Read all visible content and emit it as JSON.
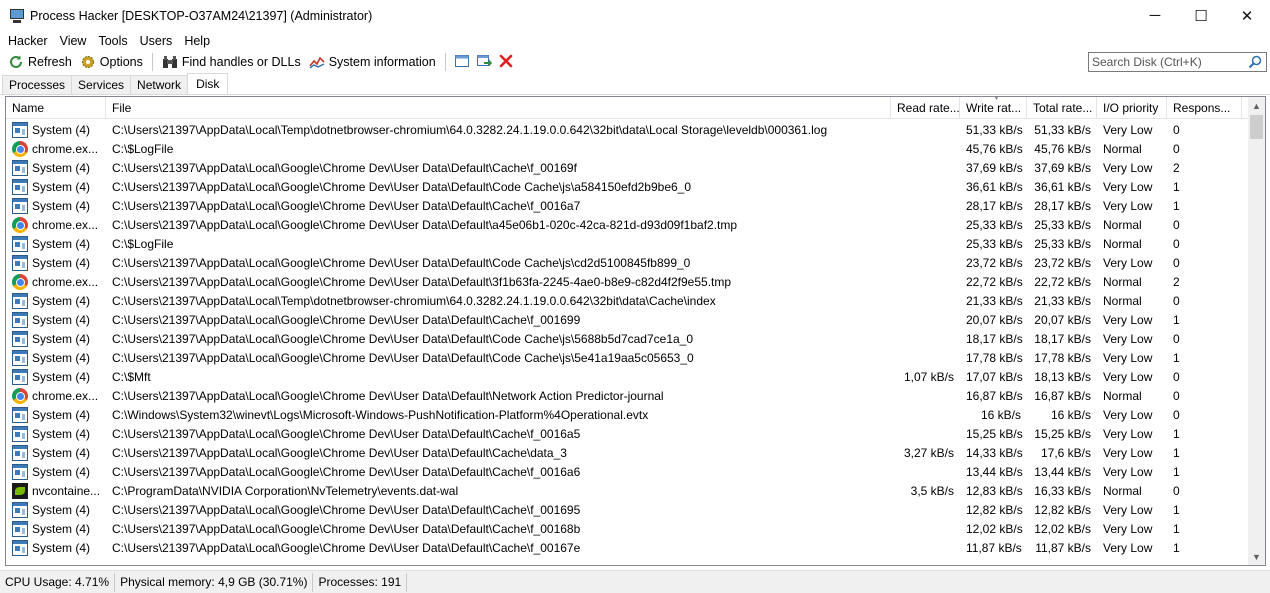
{
  "window": {
    "title": "Process Hacker [DESKTOP-O37AM24\\21397] (Administrator)",
    "controls": {
      "minimize": "─",
      "maximize": "☐",
      "close": "✕"
    }
  },
  "menu": [
    "Hacker",
    "View",
    "Tools",
    "Users",
    "Help"
  ],
  "toolbar": {
    "refresh": "Refresh",
    "options": "Options",
    "find": "Find handles or DLLs",
    "sysinfo": "System information"
  },
  "search": {
    "placeholder": "Search Disk (Ctrl+K)"
  },
  "tabs": [
    "Processes",
    "Services",
    "Network",
    "Disk"
  ],
  "active_tab": "Disk",
  "columns": [
    "Name",
    "File",
    "Read rate...",
    "Write rat...",
    "Total rate...",
    "I/O priority",
    "Respons..."
  ],
  "rows": [
    {
      "icon": "system",
      "name": "System (4)",
      "file": "C:\\Users\\21397\\AppData\\Local\\Temp\\dotnetbrowser-chromium\\64.0.3282.24.1.19.0.0.642\\32bit\\data\\Local Storage\\leveldb\\000361.log",
      "read": "",
      "write": "51,33 kB/s",
      "total": "51,33 kB/s",
      "priority": "Very Low",
      "resp": "0"
    },
    {
      "icon": "chrome",
      "name": "chrome.ex...",
      "file": "C:\\$LogFile",
      "read": "",
      "write": "45,76 kB/s",
      "total": "45,76 kB/s",
      "priority": "Normal",
      "resp": "0"
    },
    {
      "icon": "system",
      "name": "System (4)",
      "file": "C:\\Users\\21397\\AppData\\Local\\Google\\Chrome Dev\\User Data\\Default\\Cache\\f_00169f",
      "read": "",
      "write": "37,69 kB/s",
      "total": "37,69 kB/s",
      "priority": "Very Low",
      "resp": "2"
    },
    {
      "icon": "system",
      "name": "System (4)",
      "file": "C:\\Users\\21397\\AppData\\Local\\Google\\Chrome Dev\\User Data\\Default\\Code Cache\\js\\a584150efd2b9be6_0",
      "read": "",
      "write": "36,61 kB/s",
      "total": "36,61 kB/s",
      "priority": "Very Low",
      "resp": "1"
    },
    {
      "icon": "system",
      "name": "System (4)",
      "file": "C:\\Users\\21397\\AppData\\Local\\Google\\Chrome Dev\\User Data\\Default\\Cache\\f_0016a7",
      "read": "",
      "write": "28,17 kB/s",
      "total": "28,17 kB/s",
      "priority": "Very Low",
      "resp": "1"
    },
    {
      "icon": "chrome",
      "name": "chrome.ex...",
      "file": "C:\\Users\\21397\\AppData\\Local\\Google\\Chrome Dev\\User Data\\Default\\a45e06b1-020c-42ca-821d-d93d09f1baf2.tmp",
      "read": "",
      "write": "25,33 kB/s",
      "total": "25,33 kB/s",
      "priority": "Normal",
      "resp": "0"
    },
    {
      "icon": "system",
      "name": "System (4)",
      "file": "C:\\$LogFile",
      "read": "",
      "write": "25,33 kB/s",
      "total": "25,33 kB/s",
      "priority": "Normal",
      "resp": "0"
    },
    {
      "icon": "system",
      "name": "System (4)",
      "file": "C:\\Users\\21397\\AppData\\Local\\Google\\Chrome Dev\\User Data\\Default\\Code Cache\\js\\cd2d5100845fb899_0",
      "read": "",
      "write": "23,72 kB/s",
      "total": "23,72 kB/s",
      "priority": "Very Low",
      "resp": "0"
    },
    {
      "icon": "chrome",
      "name": "chrome.ex...",
      "file": "C:\\Users\\21397\\AppData\\Local\\Google\\Chrome Dev\\User Data\\Default\\3f1b63fa-2245-4ae0-b8e9-c82d4f2f9e55.tmp",
      "read": "",
      "write": "22,72 kB/s",
      "total": "22,72 kB/s",
      "priority": "Normal",
      "resp": "2"
    },
    {
      "icon": "system",
      "name": "System (4)",
      "file": "C:\\Users\\21397\\AppData\\Local\\Temp\\dotnetbrowser-chromium\\64.0.3282.24.1.19.0.0.642\\32bit\\data\\Cache\\index",
      "read": "",
      "write": "21,33 kB/s",
      "total": "21,33 kB/s",
      "priority": "Normal",
      "resp": "0"
    },
    {
      "icon": "system",
      "name": "System (4)",
      "file": "C:\\Users\\21397\\AppData\\Local\\Google\\Chrome Dev\\User Data\\Default\\Cache\\f_001699",
      "read": "",
      "write": "20,07 kB/s",
      "total": "20,07 kB/s",
      "priority": "Very Low",
      "resp": "1"
    },
    {
      "icon": "system",
      "name": "System (4)",
      "file": "C:\\Users\\21397\\AppData\\Local\\Google\\Chrome Dev\\User Data\\Default\\Code Cache\\js\\5688b5d7cad7ce1a_0",
      "read": "",
      "write": "18,17 kB/s",
      "total": "18,17 kB/s",
      "priority": "Very Low",
      "resp": "0"
    },
    {
      "icon": "system",
      "name": "System (4)",
      "file": "C:\\Users\\21397\\AppData\\Local\\Google\\Chrome Dev\\User Data\\Default\\Code Cache\\js\\5e41a19aa5c05653_0",
      "read": "",
      "write": "17,78 kB/s",
      "total": "17,78 kB/s",
      "priority": "Very Low",
      "resp": "1"
    },
    {
      "icon": "system",
      "name": "System (4)",
      "file": "C:\\$Mft",
      "read": "1,07 kB/s",
      "write": "17,07 kB/s",
      "total": "18,13 kB/s",
      "priority": "Very Low",
      "resp": "0"
    },
    {
      "icon": "chrome",
      "name": "chrome.ex...",
      "file": "C:\\Users\\21397\\AppData\\Local\\Google\\Chrome Dev\\User Data\\Default\\Network Action Predictor-journal",
      "read": "",
      "write": "16,87 kB/s",
      "total": "16,87 kB/s",
      "priority": "Normal",
      "resp": "0"
    },
    {
      "icon": "system",
      "name": "System (4)",
      "file": "C:\\Windows\\System32\\winevt\\Logs\\Microsoft-Windows-PushNotification-Platform%4Operational.evtx",
      "read": "",
      "write": "16 kB/s",
      "total": "16 kB/s",
      "priority": "Very Low",
      "resp": "0"
    },
    {
      "icon": "system",
      "name": "System (4)",
      "file": "C:\\Users\\21397\\AppData\\Local\\Google\\Chrome Dev\\User Data\\Default\\Cache\\f_0016a5",
      "read": "",
      "write": "15,25 kB/s",
      "total": "15,25 kB/s",
      "priority": "Very Low",
      "resp": "1"
    },
    {
      "icon": "system",
      "name": "System (4)",
      "file": "C:\\Users\\21397\\AppData\\Local\\Google\\Chrome Dev\\User Data\\Default\\Cache\\data_3",
      "read": "3,27 kB/s",
      "write": "14,33 kB/s",
      "total": "17,6 kB/s",
      "priority": "Very Low",
      "resp": "1"
    },
    {
      "icon": "system",
      "name": "System (4)",
      "file": "C:\\Users\\21397\\AppData\\Local\\Google\\Chrome Dev\\User Data\\Default\\Cache\\f_0016a6",
      "read": "",
      "write": "13,44 kB/s",
      "total": "13,44 kB/s",
      "priority": "Very Low",
      "resp": "1"
    },
    {
      "icon": "nvidia",
      "name": "nvcontaine...",
      "file": "C:\\ProgramData\\NVIDIA Corporation\\NvTelemetry\\events.dat-wal",
      "read": "3,5 kB/s",
      "write": "12,83 kB/s",
      "total": "16,33 kB/s",
      "priority": "Normal",
      "resp": "0"
    },
    {
      "icon": "system",
      "name": "System (4)",
      "file": "C:\\Users\\21397\\AppData\\Local\\Google\\Chrome Dev\\User Data\\Default\\Cache\\f_001695",
      "read": "",
      "write": "12,82 kB/s",
      "total": "12,82 kB/s",
      "priority": "Very Low",
      "resp": "1"
    },
    {
      "icon": "system",
      "name": "System (4)",
      "file": "C:\\Users\\21397\\AppData\\Local\\Google\\Chrome Dev\\User Data\\Default\\Cache\\f_00168b",
      "read": "",
      "write": "12,02 kB/s",
      "total": "12,02 kB/s",
      "priority": "Very Low",
      "resp": "1"
    },
    {
      "icon": "system",
      "name": "System (4)",
      "file": "C:\\Users\\21397\\AppData\\Local\\Google\\Chrome Dev\\User Data\\Default\\Cache\\f_00167e",
      "read": "",
      "write": "11,87 kB/s",
      "total": "11,87 kB/s",
      "priority": "Very Low",
      "resp": "1"
    }
  ],
  "status": {
    "cpu": "CPU Usage: 4.71%",
    "memory": "Physical memory: 4,9 GB (30.71%)",
    "processes": "Processes: 191"
  }
}
